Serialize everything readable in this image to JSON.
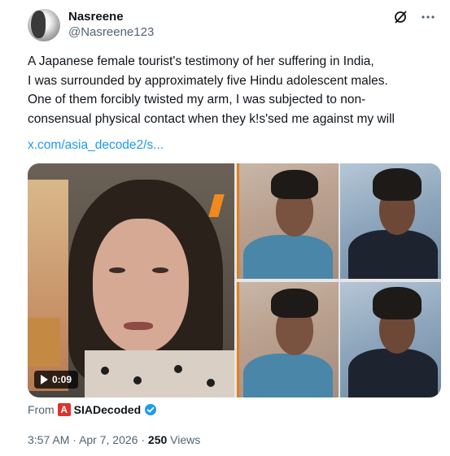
{
  "author": {
    "name": "Nasreene",
    "handle": "@Nasreene123"
  },
  "header_icons": [
    "grok-icon",
    "more-icon"
  ],
  "tweet": {
    "lines": [
      "A Japanese female tourist's testimony of her suffering in India,",
      "I was surrounded by approximately five Hindu adolescent males.",
      "One of them forcibly twisted my arm,  I was subjected to non-",
      "consensual physical contact when they k!s'sed me against my will"
    ],
    "link": "x.com/asia_decode2/s..."
  },
  "media": {
    "video_duration": "0:09"
  },
  "source": {
    "from_label": "From",
    "logo_letter": "A",
    "name": "SIADecoded"
  },
  "meta": {
    "time": "3:57 AM",
    "separator": "·",
    "date": "Apr 7, 2026",
    "views_count": "250",
    "views_label": "Views"
  },
  "colors": {
    "link": "#1d9bf0",
    "secondary_text": "#536471",
    "verified": "#1d9bf0",
    "source_logo": "#e0322b"
  }
}
